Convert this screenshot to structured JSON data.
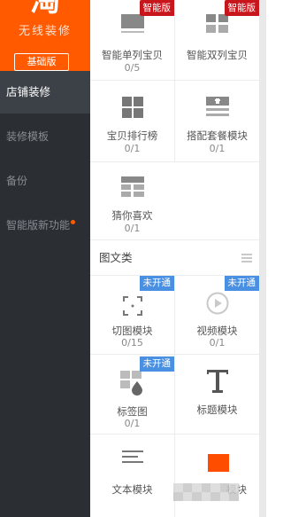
{
  "sidebar": {
    "logo_glyph": "淘",
    "brand_sub": "无线装修",
    "plan_badge": "基础版",
    "items": [
      {
        "label": "店铺装修",
        "active": true
      },
      {
        "label": "装修模板",
        "active": false
      },
      {
        "label": "备份",
        "active": false
      },
      {
        "label": "智能版新功能",
        "active": false,
        "dot": true
      }
    ]
  },
  "tags": {
    "smart": "智能版",
    "not_enabled": "未开通"
  },
  "modules": [
    {
      "key": "single",
      "title": "智能单列宝贝",
      "count": "0/5",
      "icon": "single-column-icon",
      "tag": "智能版"
    },
    {
      "key": "double",
      "title": "智能双列宝贝",
      "count": "",
      "icon": "double-column-icon",
      "tag": "智能版"
    },
    {
      "key": "rank",
      "title": "宝贝排行榜",
      "count": "0/1",
      "icon": "ranking-grid-icon"
    },
    {
      "key": "combo",
      "title": "搭配套餐模块",
      "count": "0/1",
      "icon": "combo-package-icon"
    },
    {
      "key": "guess",
      "title": "猜你喜欢",
      "count": "0/1",
      "icon": "guess-you-like-icon"
    }
  ],
  "section": {
    "title": "图文类"
  },
  "media_modules": [
    {
      "key": "crop",
      "title": "切图模块",
      "count": "0/15",
      "icon": "crop-image-icon",
      "tag": "未开通"
    },
    {
      "key": "video",
      "title": "视频模块",
      "count": "0/1",
      "icon": "video-play-icon",
      "tag": "未开通"
    },
    {
      "key": "label",
      "title": "标签图",
      "count": "0/1",
      "icon": "tag-image-icon",
      "tag": "未开通"
    },
    {
      "key": "heading",
      "title": "标题模块",
      "count": "",
      "icon": "title-text-icon"
    },
    {
      "key": "text",
      "title": "文本模块",
      "count": "",
      "icon": "text-lines-icon"
    },
    {
      "key": "partial",
      "title": "模块",
      "count": "",
      "icon": "orange-block-icon"
    }
  ],
  "colors": {
    "accent": "#ff5a00",
    "sidebar_bg": "#2b2f33",
    "smart_tag": "#c8161d",
    "closed_tag": "#4a90e2"
  }
}
